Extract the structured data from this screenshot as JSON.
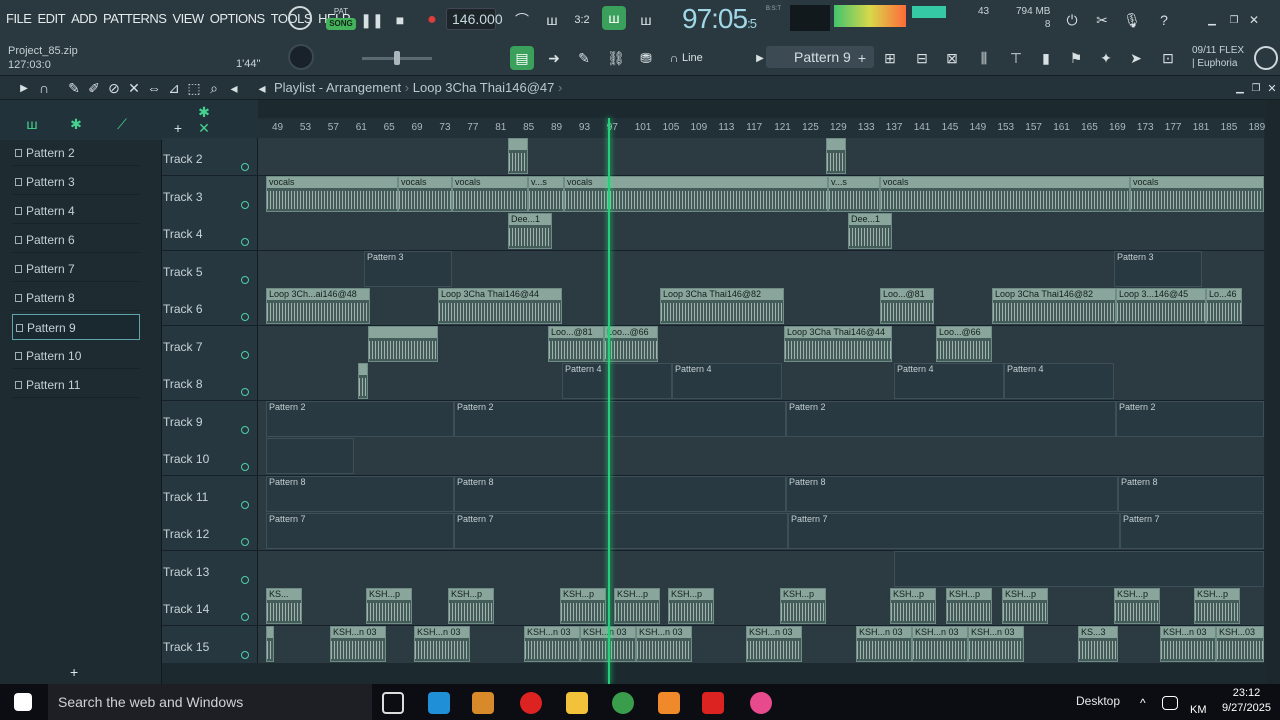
{
  "menu": [
    "FILE",
    "EDIT",
    "ADD",
    "PATTERNS",
    "VIEW",
    "OPTIONS",
    "TOOLS",
    "HELP"
  ],
  "transport": {
    "pat": "PAT",
    "song": "SONG",
    "tempo": "146.000",
    "time_main": "97:05",
    "time_sub": "5",
    "time_label": "B:S:T"
  },
  "monitor": {
    "cpu": "43",
    "mem": "794 MB",
    "voices": "8"
  },
  "project": {
    "name": "Project_85.zip",
    "position": "127:03:0",
    "time": "1'44\""
  },
  "snap": "Line",
  "current_pattern": "Pattern 9",
  "flex": {
    "date": "09/11",
    "name": "FLEX",
    "preset": "| Euphoria"
  },
  "playlist": {
    "title": "Playlist - Arrangement",
    "clip": "Loop 3Cha Thai146@47"
  },
  "patterns": [
    "Pattern 2",
    "Pattern 3",
    "Pattern 4",
    "Pattern 6",
    "Pattern 7",
    "Pattern 8",
    "Pattern 9",
    "Pattern 10",
    "Pattern 11"
  ],
  "ruler": [
    "49",
    "53",
    "57",
    "61",
    "65",
    "69",
    "73",
    "77",
    "81",
    "85",
    "89",
    "93",
    "97",
    "101",
    "105",
    "109",
    "113",
    "117",
    "121",
    "125",
    "129",
    "133",
    "137",
    "141",
    "145",
    "149",
    "153",
    "157",
    "161",
    "165",
    "169",
    "173",
    "177",
    "181",
    "185",
    "189"
  ],
  "tracks": [
    {
      "name": "Track 2",
      "clips": [
        {
          "l": 250,
          "w": 20,
          "t": "",
          "a": 1
        },
        {
          "l": 568,
          "w": 20,
          "t": "",
          "a": 1
        }
      ]
    },
    {
      "name": "Track 3",
      "clips": [
        {
          "l": 8,
          "w": 132,
          "t": "vocals",
          "a": 1
        },
        {
          "l": 140,
          "w": 54,
          "t": "vocals",
          "a": 1
        },
        {
          "l": 194,
          "w": 76,
          "t": "vocals",
          "a": 1
        },
        {
          "l": 270,
          "w": 36,
          "t": "v...s",
          "a": 1
        },
        {
          "l": 306,
          "w": 264,
          "t": "vocals",
          "a": 1
        },
        {
          "l": 570,
          "w": 52,
          "t": "v...s",
          "a": 1
        },
        {
          "l": 622,
          "w": 250,
          "t": "vocals",
          "a": 1
        },
        {
          "l": 872,
          "w": 134,
          "t": "vocals",
          "a": 1
        }
      ]
    },
    {
      "name": "Track 4",
      "clips": [
        {
          "l": 250,
          "w": 44,
          "t": "Dee...1",
          "a": 1
        },
        {
          "l": 590,
          "w": 44,
          "t": "Dee...1",
          "a": 1
        }
      ]
    },
    {
      "name": "Track 5",
      "clips": [
        {
          "l": 106,
          "w": 88,
          "t": "Pattern 3",
          "a": 0
        },
        {
          "l": 856,
          "w": 88,
          "t": "Pattern 3",
          "a": 0
        }
      ]
    },
    {
      "name": "Track 6",
      "clips": [
        {
          "l": 8,
          "w": 104,
          "t": "Loop 3Ch...ai146@48",
          "a": 1
        },
        {
          "l": 180,
          "w": 124,
          "t": "Loop 3Cha Thai146@44",
          "a": 1
        },
        {
          "l": 402,
          "w": 124,
          "t": "Loop 3Cha Thai146@82",
          "a": 1
        },
        {
          "l": 622,
          "w": 54,
          "t": "Loo...@81",
          "a": 1
        },
        {
          "l": 734,
          "w": 124,
          "t": "Loop 3Cha Thai146@82",
          "a": 1
        },
        {
          "l": 858,
          "w": 90,
          "t": "Loop 3...146@45",
          "a": 1
        },
        {
          "l": 948,
          "w": 36,
          "t": "Lo...46",
          "a": 1
        }
      ]
    },
    {
      "name": "Track 7",
      "clips": [
        {
          "l": 110,
          "w": 70,
          "t": "",
          "a": 1
        },
        {
          "l": 290,
          "w": 56,
          "t": "Loo...@81",
          "a": 1
        },
        {
          "l": 346,
          "w": 54,
          "t": "Loo...@66",
          "a": 1
        },
        {
          "l": 526,
          "w": 108,
          "t": "Loop 3Cha Thai146@44",
          "a": 1
        },
        {
          "l": 678,
          "w": 56,
          "t": "Loo...@66",
          "a": 1
        }
      ]
    },
    {
      "name": "Track 8",
      "clips": [
        {
          "l": 100,
          "w": 10,
          "t": "",
          "a": 1
        },
        {
          "l": 304,
          "w": 110,
          "t": "Pattern 4",
          "a": 0
        },
        {
          "l": 414,
          "w": 110,
          "t": "Pattern 4",
          "a": 0
        },
        {
          "l": 636,
          "w": 110,
          "t": "Pattern 4",
          "a": 0
        },
        {
          "l": 746,
          "w": 110,
          "t": "Pattern 4",
          "a": 0
        }
      ]
    },
    {
      "name": "Track 9",
      "clips": [
        {
          "l": 8,
          "w": 188,
          "t": "Pattern 2",
          "a": 0
        },
        {
          "l": 196,
          "w": 332,
          "t": "Pattern 2",
          "a": 0
        },
        {
          "l": 528,
          "w": 330,
          "t": "Pattern 2",
          "a": 0
        },
        {
          "l": 858,
          "w": 148,
          "t": "Pattern 2",
          "a": 0
        }
      ]
    },
    {
      "name": "Track 10",
      "clips": [
        {
          "l": 8,
          "w": 88,
          "t": "",
          "a": 0
        }
      ]
    },
    {
      "name": "Track 11",
      "clips": [
        {
          "l": 8,
          "w": 188,
          "t": "Pattern 8",
          "a": 0
        },
        {
          "l": 196,
          "w": 332,
          "t": "Pattern 8",
          "a": 0
        },
        {
          "l": 528,
          "w": 332,
          "t": "Pattern 8",
          "a": 0
        },
        {
          "l": 860,
          "w": 146,
          "t": "Pattern 8",
          "a": 0
        }
      ]
    },
    {
      "name": "Track 12",
      "clips": [
        {
          "l": 8,
          "w": 188,
          "t": "Pattern 7",
          "a": 0
        },
        {
          "l": 196,
          "w": 334,
          "t": "Pattern 7",
          "a": 0
        },
        {
          "l": 530,
          "w": 332,
          "t": "Pattern 7",
          "a": 0
        },
        {
          "l": 862,
          "w": 144,
          "t": "Pattern 7",
          "a": 0
        }
      ]
    },
    {
      "name": "Track 13",
      "clips": [
        {
          "l": 636,
          "w": 370,
          "t": "",
          "a": 0
        }
      ]
    },
    {
      "name": "Track 14",
      "clips": [
        {
          "l": 8,
          "w": 36,
          "t": "KS...",
          "a": 1
        },
        {
          "l": 108,
          "w": 46,
          "t": "KSH...p",
          "a": 1
        },
        {
          "l": 190,
          "w": 46,
          "t": "KSH...p",
          "a": 1
        },
        {
          "l": 302,
          "w": 46,
          "t": "KSH...p",
          "a": 1
        },
        {
          "l": 356,
          "w": 46,
          "t": "KSH...p",
          "a": 1
        },
        {
          "l": 410,
          "w": 46,
          "t": "KSH...p",
          "a": 1
        },
        {
          "l": 522,
          "w": 46,
          "t": "KSH...p",
          "a": 1
        },
        {
          "l": 632,
          "w": 46,
          "t": "KSH...p",
          "a": 1
        },
        {
          "l": 688,
          "w": 46,
          "t": "KSH...p",
          "a": 1
        },
        {
          "l": 744,
          "w": 46,
          "t": "KSH...p",
          "a": 1
        },
        {
          "l": 856,
          "w": 46,
          "t": "KSH...p",
          "a": 1
        },
        {
          "l": 936,
          "w": 46,
          "t": "KSH...p",
          "a": 1
        }
      ]
    },
    {
      "name": "Track 15",
      "clips": [
        {
          "l": 8,
          "w": 8,
          "t": "",
          "a": 1
        },
        {
          "l": 72,
          "w": 56,
          "t": "KSH...n 03",
          "a": 1
        },
        {
          "l": 156,
          "w": 56,
          "t": "KSH...n 03",
          "a": 1
        },
        {
          "l": 266,
          "w": 56,
          "t": "KSH...n 03",
          "a": 1
        },
        {
          "l": 322,
          "w": 56,
          "t": "KSH...n 03",
          "a": 1
        },
        {
          "l": 378,
          "w": 56,
          "t": "KSH...n 03",
          "a": 1
        },
        {
          "l": 488,
          "w": 56,
          "t": "KSH...n 03",
          "a": 1
        },
        {
          "l": 598,
          "w": 56,
          "t": "KSH...n 03",
          "a": 1
        },
        {
          "l": 654,
          "w": 56,
          "t": "KSH...n 03",
          "a": 1
        },
        {
          "l": 710,
          "w": 56,
          "t": "KSH...n 03",
          "a": 1
        },
        {
          "l": 820,
          "w": 40,
          "t": "KS...3",
          "a": 1
        },
        {
          "l": 902,
          "w": 56,
          "t": "KSH...n 03",
          "a": 1
        },
        {
          "l": 958,
          "w": 48,
          "t": "KSH...03",
          "a": 1
        }
      ]
    }
  ],
  "taskbar": {
    "search": "Search the web and Windows",
    "desktop": "Desktop",
    "time": "23:12",
    "date": "9/27/2025",
    "lang": "KM"
  },
  "colors": {
    "accent": "#25d07a",
    "bg": "#2c3a42"
  }
}
